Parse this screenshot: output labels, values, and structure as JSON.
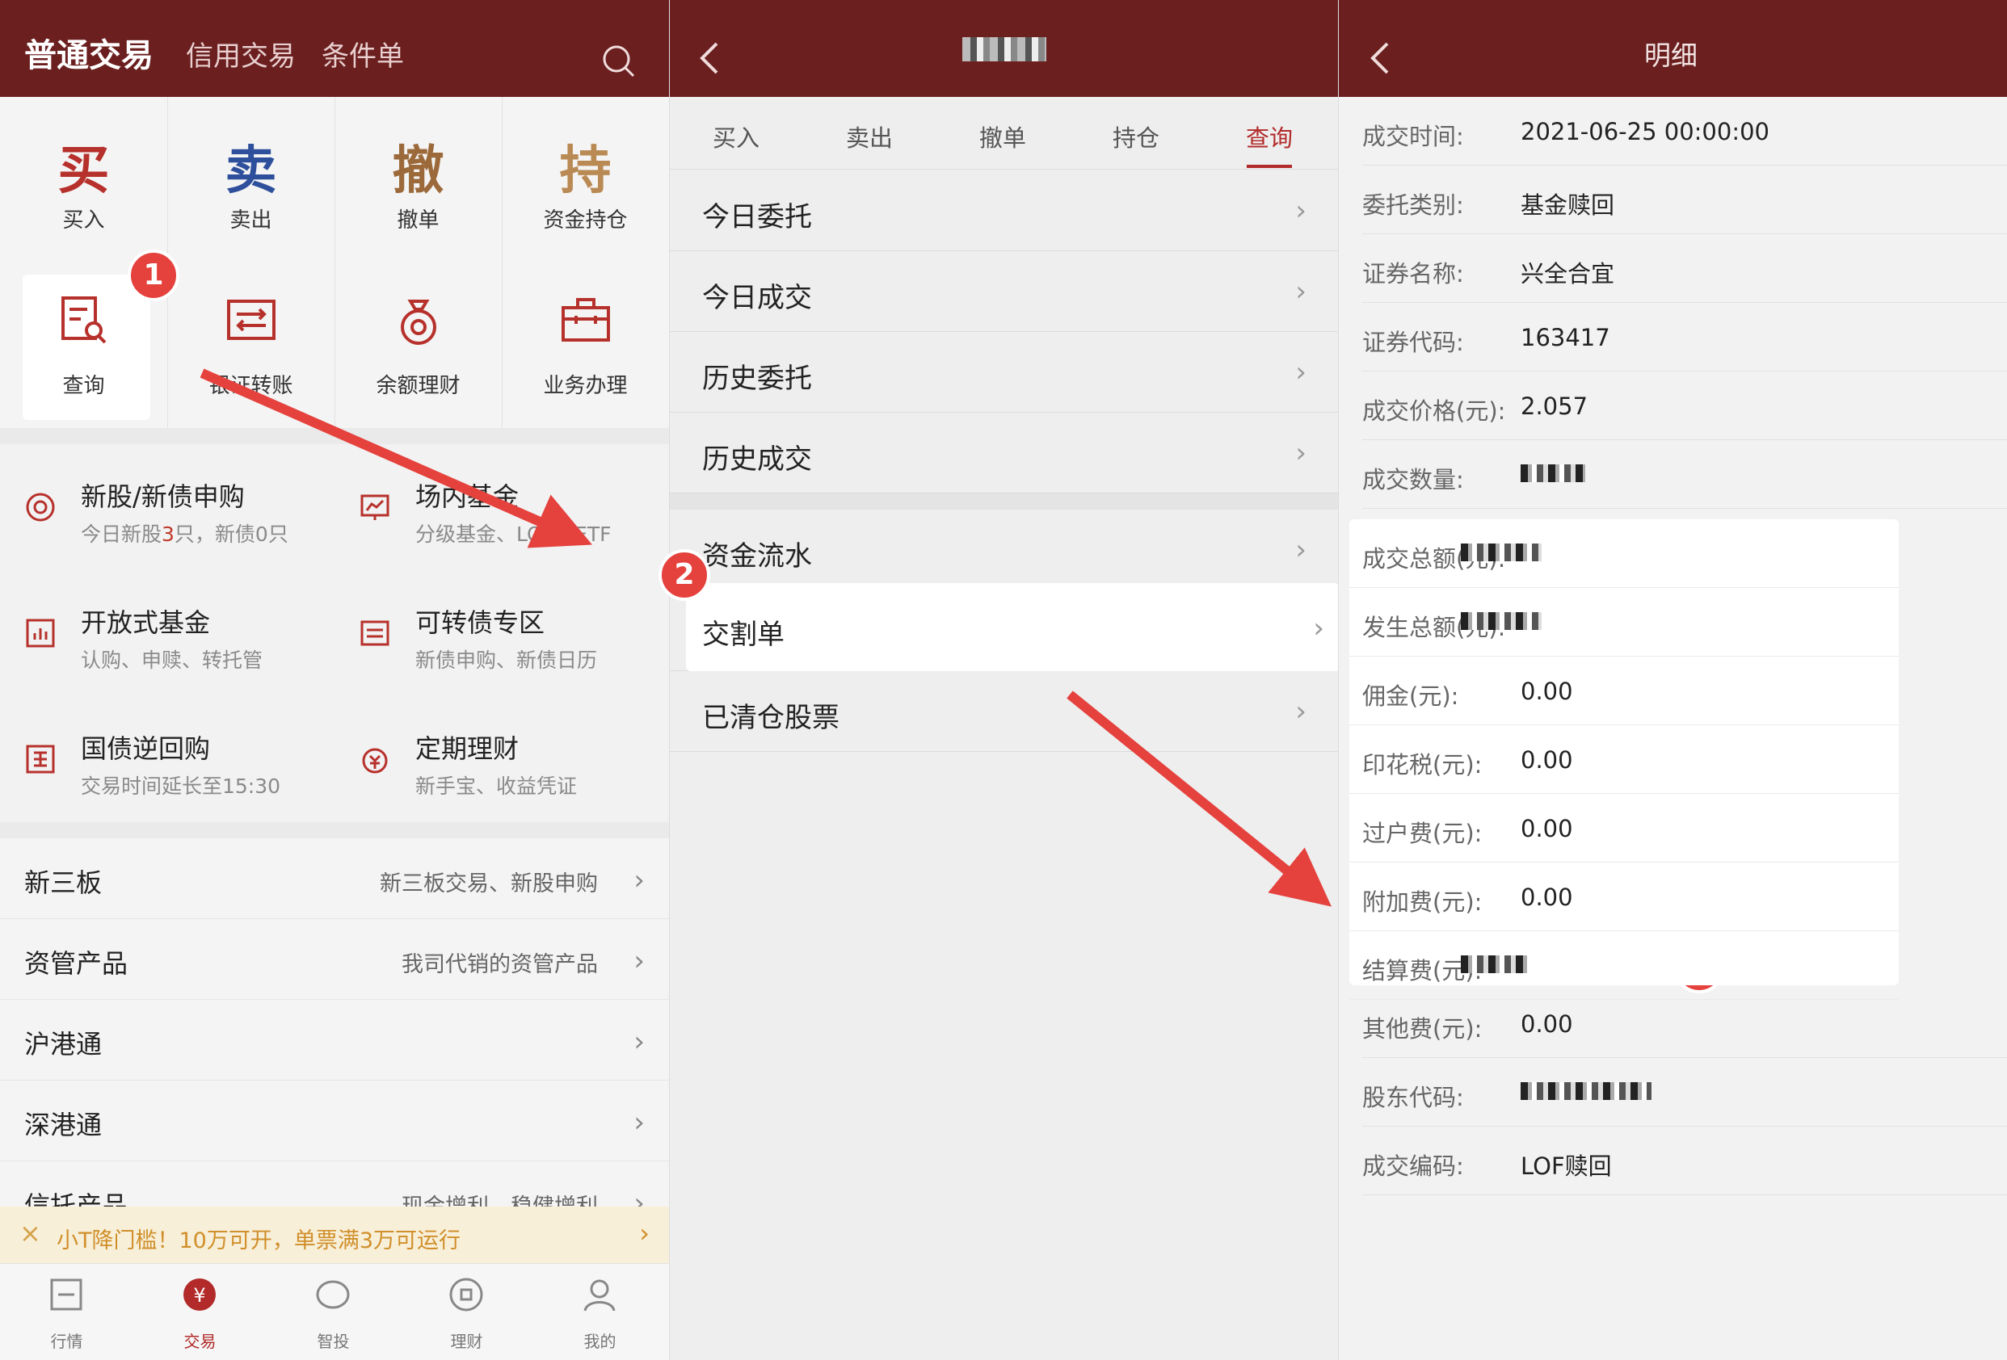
{
  "panel1": {
    "tabs": [
      "普通交易",
      "信用交易",
      "条件单"
    ],
    "grid": [
      {
        "big": "买",
        "label": "买入",
        "color": "#b7312c"
      },
      {
        "big": "卖",
        "label": "卖出",
        "color": "#2e4f9b"
      },
      {
        "big": "撤",
        "label": "撤单",
        "color": "#9c6a3a"
      },
      {
        "big": "持",
        "label": "资金持仓",
        "color": "#b98a54"
      }
    ],
    "grid2": [
      {
        "label": "查询",
        "icon": "search-doc-icon"
      },
      {
        "label": "银证转账",
        "icon": "transfer-icon"
      },
      {
        "label": "余额理财",
        "icon": "money-bag-icon"
      },
      {
        "label": "业务办理",
        "icon": "briefcase-icon"
      }
    ],
    "services": [
      {
        "name": "新股/新债申购",
        "sub_a": "今日新股",
        "sub_b": "3",
        "sub_c": "只，新债0只",
        "icon": "ipo-icon"
      },
      {
        "name": "场内基金",
        "sub": "分级基金、LOF、ETF",
        "icon": "chart-board-icon"
      },
      {
        "name": "开放式基金",
        "sub": "认购、申赎、转托管",
        "icon": "bar-chart-icon"
      },
      {
        "name": "可转债专区",
        "sub": "新债申购、新债日历",
        "icon": "bond-icon"
      },
      {
        "name": "国债逆回购",
        "sub": "交易时间延长至15:30",
        "icon": "national-debt-icon"
      },
      {
        "name": "定期理财",
        "sub": "新手宝、收益凭证",
        "icon": "yuan-clock-icon"
      }
    ],
    "rows": [
      {
        "name": "新三板",
        "desc": "新三板交易、新股申购"
      },
      {
        "name": "资管产品",
        "desc": "我司代销的资管产品"
      },
      {
        "name": "沪港通",
        "desc": ""
      },
      {
        "name": "深港通",
        "desc": ""
      },
      {
        "name": "信托产品",
        "desc": "现金增利、稳健增利"
      }
    ],
    "banner": "小T降门槛！10万可开，单票满3万可运行",
    "tabbar": [
      "行情",
      "交易",
      "智投",
      "理财",
      "我的"
    ]
  },
  "panel2": {
    "subtabs": [
      "买入",
      "卖出",
      "撤单",
      "持仓",
      "查询"
    ],
    "group1": [
      "今日委托",
      "今日成交",
      "历史委托",
      "历史成交"
    ],
    "group2": [
      "资金流水",
      "交割单",
      "已清仓股票"
    ]
  },
  "panel3": {
    "title": "明细",
    "rows": [
      {
        "k": "成交时间:",
        "v": "2021-06-25 00:00:00"
      },
      {
        "k": "委托类别:",
        "v": "基金赎回"
      },
      {
        "k": "证券名称:",
        "v": "兴全合宜"
      },
      {
        "k": "证券代码:",
        "v": "163417"
      },
      {
        "k": "成交价格(元):",
        "v": "2.057"
      },
      {
        "k": "成交数量:",
        "v": ""
      },
      {
        "k": "成交总额(元):",
        "v": ""
      },
      {
        "k": "发生总额(元):",
        "v": ""
      },
      {
        "k": "佣金(元):",
        "v": "0.00"
      },
      {
        "k": "印花税(元):",
        "v": "0.00"
      },
      {
        "k": "过户费(元):",
        "v": "0.00"
      },
      {
        "k": "附加费(元):",
        "v": "0.00"
      },
      {
        "k": "结算费(元):",
        "v": ""
      },
      {
        "k": "其他费(元):",
        "v": "0.00"
      },
      {
        "k": "股东代码:",
        "v": ""
      },
      {
        "k": "成交编码:",
        "v": "LOF赎回"
      }
    ]
  },
  "badges": [
    "1",
    "2",
    "3"
  ],
  "colors": {
    "header": "#6b1f1f",
    "accent": "#b22a2a",
    "arrow": "#e5413d"
  }
}
